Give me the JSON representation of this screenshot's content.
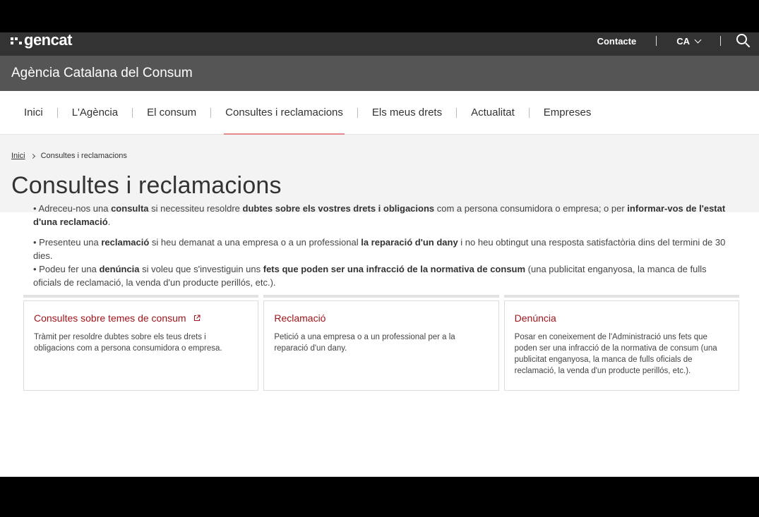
{
  "topbar": {
    "logo_text": "gencat",
    "contact_label": "Contacte",
    "language_label": "CA",
    "icons": [
      "chevron-down-icon",
      "search-icon"
    ]
  },
  "agency": {
    "name": "Agència Catalana del Consum"
  },
  "nav": {
    "items": [
      {
        "label": "Inici"
      },
      {
        "label": "L'Agència"
      },
      {
        "label": "El consum"
      },
      {
        "label": "Consultes i reclamacions"
      },
      {
        "label": "Els meus drets"
      },
      {
        "label": "Actualitat"
      },
      {
        "label": "Empreses"
      }
    ],
    "active_index": 3
  },
  "breadcrumb": {
    "home": "Inici",
    "current": "Consultes i reclamacions"
  },
  "page_title": "Consultes i reclamacions",
  "intro": {
    "p1": {
      "t1": "• Adreceu-nos una ",
      "b1": "consulta",
      "t2": " si necessiteu resoldre ",
      "b2": "dubtes sobre els vostres drets i obligacions",
      "t3": " com a persona consumidora o empresa; o per ",
      "b3": "informar-vos de l'estat d'una reclamació",
      "t4": "."
    },
    "p2": {
      "t1": "• Presenteu una ",
      "b1": "reclamació",
      "t2": " si heu demanat a una empresa o a un professional ",
      "b2": "la reparació d'un dany",
      "t3": " i no heu obtingut una resposta satisfactòria dins del termini de 30 dies."
    },
    "p3": {
      "t1": "• Podeu fer una ",
      "b1": "denúncia",
      "t2": " si voleu que s'investiguin uns ",
      "b2": "fets que poden ser una infracció de la normativa de consum",
      "t3": " (una publicitat enganyosa, la manca de fulls oficials de reclamació, la venda d'un producte perillós, etc.)."
    }
  },
  "cards": [
    {
      "title": "Consultes sobre temes de consum",
      "desc": "Tràmit per resoldre dubtes sobre els teus drets i obligacions com a persona consumidora o empresa.",
      "icon": "external-link-icon"
    },
    {
      "title": "Reclamació",
      "desc": "Petició a una empresa o a un professional per a la reparació d'un dany."
    },
    {
      "title": "Denúncia",
      "desc": "Posar en coneixement de l'Administració uns fets que poden ser una infracció de la normativa de consum (una publicitat enganyosa, la manca de fulls oficials de reclamació, la venda d'un producte perillós, etc.)."
    }
  ],
  "colors": {
    "topbar_bg": "#333333",
    "agency_bg": "#555555",
    "accent_red": "#a0151b",
    "active_underline": "#e7898c"
  }
}
